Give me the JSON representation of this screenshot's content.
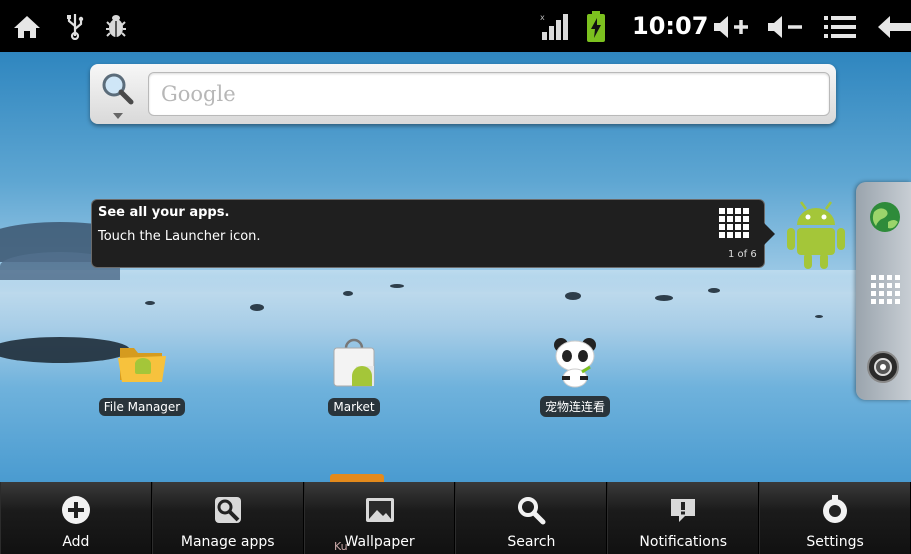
{
  "status_bar": {
    "time": "10:07",
    "icons": [
      "home-icon",
      "usb-icon",
      "debug-bug-icon",
      "signal-icon",
      "battery-charging-icon",
      "volume-up-icon",
      "volume-down-icon",
      "menu-list-icon",
      "back-arrow-icon"
    ]
  },
  "search": {
    "placeholder": "Google"
  },
  "hint": {
    "title": "See all your apps.",
    "subtitle": "Touch the Launcher icon.",
    "page": "1 of 6"
  },
  "desktop_icons": [
    {
      "label": "File Manager"
    },
    {
      "label": "Market"
    },
    {
      "label": "宠物连连看"
    }
  ],
  "partial_icon_label": "Ku",
  "menu": [
    {
      "label": "Add",
      "icon": "add-circle-icon"
    },
    {
      "label": "Manage apps",
      "icon": "wrench-icon"
    },
    {
      "label": "Wallpaper",
      "icon": "picture-icon"
    },
    {
      "label": "Search",
      "icon": "search-icon"
    },
    {
      "label": "Notifications",
      "icon": "notification-icon"
    },
    {
      "label": "Settings",
      "icon": "gear-icon"
    }
  ],
  "colors": {
    "status_bar": "#000000",
    "battery_green": "#7cc11f",
    "android_green": "#a4c639"
  }
}
